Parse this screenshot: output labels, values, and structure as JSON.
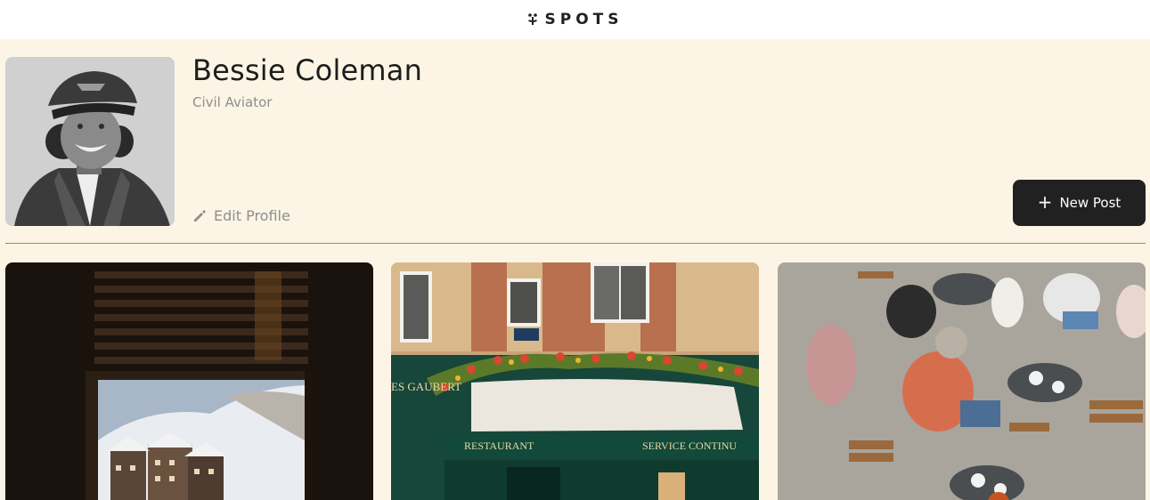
{
  "header": {
    "logo_icon": "sprout-icon",
    "logo_text": "SPOTS"
  },
  "profile": {
    "name": "Bessie Coleman",
    "description": "Civil Aviator",
    "edit_label": "Edit Profile",
    "edit_icon": "pencil-icon"
  },
  "actions": {
    "new_post_label": "New Post",
    "new_post_icon": "plus-icon"
  },
  "cards": [
    {
      "image": "snowy-mountain-village-through-window",
      "awning_text": []
    },
    {
      "image": "parisian-restaurant-storefront",
      "awning_text": [
        "ES GAUBERT",
        "RESTAURANT",
        "SERVICE CONTINU"
      ]
    },
    {
      "image": "outdoor-cafe-terrace-from-above",
      "awning_text": []
    }
  ],
  "colors": {
    "background": "#fcf5e5",
    "button": "#212121",
    "muted_text": "#8e8e8e",
    "divider": "#958b7a"
  }
}
